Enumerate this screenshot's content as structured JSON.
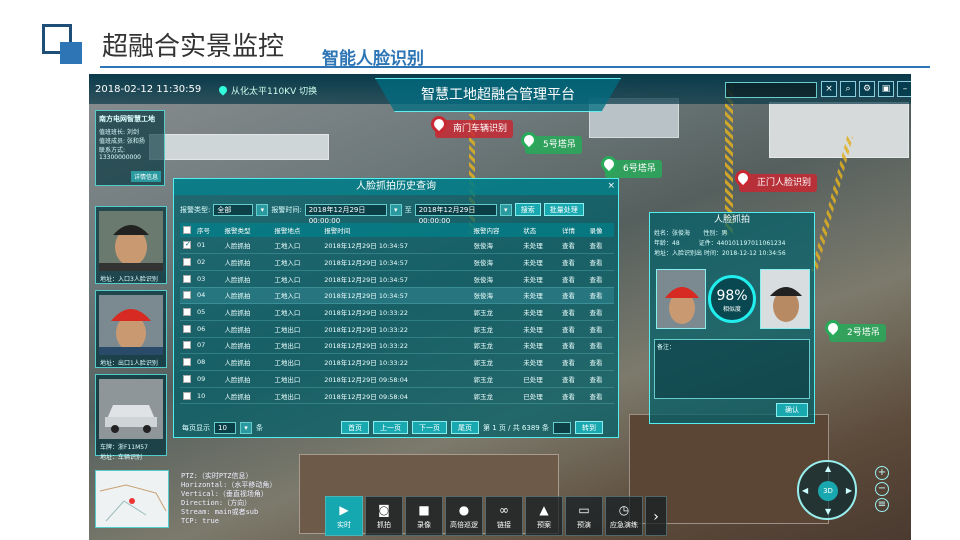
{
  "slide": {
    "title": "超融合实景监控",
    "subtitle": "智能人脸识别"
  },
  "topbar": {
    "datetime": "2018-02-12   11:30:59",
    "location": "从化太平110KV 切换",
    "platform_title": "智慧工地超融合管理平台",
    "search_value": "",
    "icons": [
      "close-icon",
      "search-icon",
      "gear-icon",
      "lock-icon",
      "minimize-icon",
      "power-icon"
    ]
  },
  "markers": [
    {
      "label": "南门车辆识别",
      "color": "red"
    },
    {
      "label": "5号塔吊",
      "color": "green"
    },
    {
      "label": "6号塔吊",
      "color": "green"
    },
    {
      "label": "正门人脸识别",
      "color": "red"
    },
    {
      "label": "2号塔吊",
      "color": "green"
    }
  ],
  "info_card": {
    "title": "南方电网智慧工地",
    "lines": [
      "值班班长: 刘剑",
      "值班成员: 张和扬",
      "联系方式:",
      "13300000000"
    ],
    "button": "详情信息"
  },
  "faces": [
    {
      "caption": "地址：入口3人脸识别",
      "caption2": ""
    },
    {
      "caption": "地址：出口1人脸识别",
      "caption2": ""
    },
    {
      "caption": "车牌：浙F11M57",
      "caption2": "地址：车辆识别"
    }
  ],
  "query": {
    "title": "人脸抓拍历史查询",
    "type_label": "报警类型:",
    "type_value": "全部",
    "time_label": "报警时间:",
    "time_from": "2018年12月29日 00:00:00",
    "to_label": "至",
    "time_to": "2018年12月29日 00:00:00",
    "search_btn": "搜索",
    "batch_btn": "批量处理",
    "columns": [
      "序号",
      "报警类型",
      "报警地点",
      "报警时间",
      "报警内容",
      "状态",
      "详情",
      "录像"
    ],
    "rows": [
      [
        "01",
        "人脸抓拍",
        "工地入口",
        "2018年12月29日 10:34:57",
        "张俊海",
        "未处理",
        "查看",
        "查看"
      ],
      [
        "02",
        "人脸抓拍",
        "工地入口",
        "2018年12月29日 10:34:57",
        "张俊海",
        "未处理",
        "查看",
        "查看"
      ],
      [
        "03",
        "人脸抓拍",
        "工地入口",
        "2018年12月29日 10:34:57",
        "张俊海",
        "未处理",
        "查看",
        "查看"
      ],
      [
        "04",
        "人脸抓拍",
        "工地入口",
        "2018年12月29日 10:34:57",
        "张俊海",
        "未处理",
        "查看",
        "查看"
      ],
      [
        "05",
        "人脸抓拍",
        "工地入口",
        "2018年12月29日 10:33:22",
        "郭玉龙",
        "未处理",
        "查看",
        "查看"
      ],
      [
        "06",
        "人脸抓拍",
        "工地出口",
        "2018年12月29日 10:33:22",
        "郭玉龙",
        "未处理",
        "查看",
        "查看"
      ],
      [
        "07",
        "人脸抓拍",
        "工地出口",
        "2018年12月29日 10:33:22",
        "郭玉龙",
        "未处理",
        "查看",
        "查看"
      ],
      [
        "08",
        "人脸抓拍",
        "工地出口",
        "2018年12月29日 10:33:22",
        "郭玉龙",
        "未处理",
        "查看",
        "查看"
      ],
      [
        "09",
        "人脸抓拍",
        "工地出口",
        "2018年12月29日 09:58:04",
        "郭玉龙",
        "已处理",
        "查看",
        "查看"
      ],
      [
        "10",
        "人脸抓拍",
        "工地出口",
        "2018年12月29日 09:58:04",
        "郭玉龙",
        "已处理",
        "查看",
        "查看"
      ]
    ],
    "per_page_label": "每页显示",
    "per_page": "10",
    "per_page_unit": "条",
    "first": "首页",
    "prev": "上一页",
    "next": "下一页",
    "last": "尾页",
    "page_info": "第 1 页 / 共 6389 条",
    "jump": "转到"
  },
  "capture": {
    "title": "人脸抓拍",
    "name": "姓名：张俊海",
    "gender": "性别：男",
    "age": "年龄：48",
    "id": "证件：440101197011061234",
    "addr": "地址：入脸识别出",
    "time": "时间：2018-12-12 10:34:56",
    "score": "98%",
    "score_label": "相似度",
    "note_label": "备注：",
    "ok": "确认"
  },
  "ptz": [
    "PTZ:（实时PTZ信息）",
    "Horizontal:（水平移动角）",
    "Vertical:（垂直视场角）",
    "Direction:（方向）",
    "Stream: main或者sub",
    "TCP: true"
  ],
  "toolbar": [
    {
      "label": "实时",
      "icon": "play-icon",
      "active": true
    },
    {
      "label": "抓拍",
      "icon": "camera-icon",
      "active": false
    },
    {
      "label": "录像",
      "icon": "video-icon",
      "active": false
    },
    {
      "label": "高倍巡逻",
      "icon": "patrol-icon",
      "active": false
    },
    {
      "label": "链接",
      "icon": "link-icon",
      "active": false
    },
    {
      "label": "预案",
      "icon": "plan-icon",
      "active": false
    },
    {
      "label": "预演",
      "icon": "preview-icon",
      "active": false
    },
    {
      "label": "应急演练",
      "icon": "timer-icon",
      "active": false
    }
  ],
  "dial": {
    "center": "3D"
  }
}
